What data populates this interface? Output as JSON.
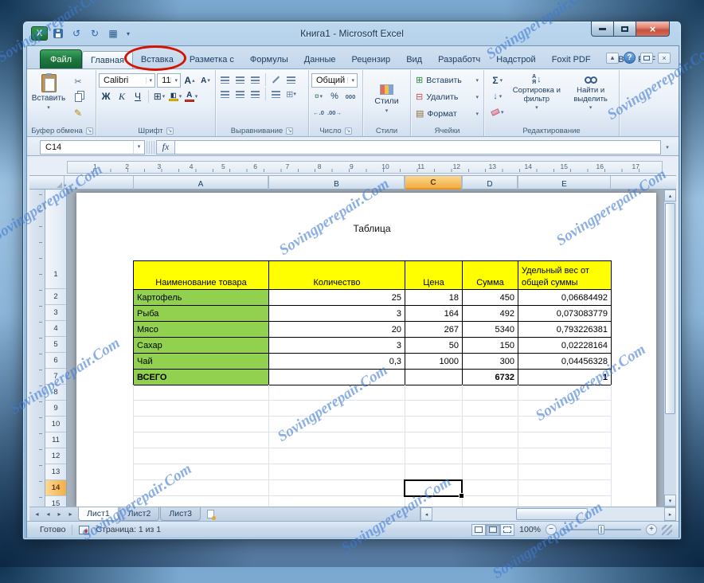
{
  "colors": {
    "table_header_yellow": "#ffff00",
    "table_row_green": "#92d050",
    "highlight_red": "#d21404",
    "header_highlight_orange": "#f3ae45",
    "file_tab_green": "#1e7a41"
  },
  "watermark": {
    "text": "Sovingperepair.Com"
  },
  "window": {
    "title": "Книга1 - Microsoft Excel"
  },
  "icons": {
    "dropdown": "▾",
    "dropup": "▴",
    "undo": "↺",
    "redo": "↻",
    "grid": "▦",
    "customize": "▾",
    "scissors": "✂",
    "brush": "✎",
    "sigma": "Σ",
    "fill_down": "↓",
    "borders": "⊞",
    "money": "¤",
    "percent": "%",
    "thousands": "000",
    "dec_inc": "←.0",
    "dec_dec": ".00→",
    "insert_cells": "⊞",
    "delete_cells": "⊟",
    "format_cells": "▤",
    "help": "?",
    "close_small": "×",
    "launcher": "↘",
    "nav_first": "◂",
    "nav_prev": "◂",
    "nav_next": "▸",
    "nav_last": "▸",
    "left": "◂",
    "right": "▸",
    "up": "▴",
    "down": "▾",
    "zoom_out": "−",
    "zoom_in": "+",
    "excel_logo": "X",
    "sort_a": "А",
    "sort_z": "Я",
    "sort_arrow": "↓",
    "grow_a": "А",
    "shrink_a": "А"
  },
  "ribbon": {
    "tabs": [
      "Файл",
      "Главная",
      "Вставка",
      "Разметка с",
      "Формулы",
      "Данные",
      "Рецензир",
      "Вид",
      "Разработч",
      "Надстрой",
      "Foxit PDF",
      "ABBYY PDF"
    ],
    "clipboard": {
      "paste": "Вставить",
      "label": "Буфер обмена"
    },
    "font": {
      "name": "Calibri",
      "size": "11",
      "bold": "Ж",
      "italic": "К",
      "underline": "Ч",
      "label": "Шрифт"
    },
    "alignment": {
      "label": "Выравнивание"
    },
    "number": {
      "format": "Общий",
      "label": "Число"
    },
    "styles": {
      "button": "Стили",
      "label": "Стили"
    },
    "cells": {
      "insert": "Вставить",
      "delete": "Удалить",
      "format": "Формат",
      "label": "Ячейки"
    },
    "editing": {
      "sort": "Сортировка и фильтр",
      "find": "Найти и выделить",
      "label": "Редактирование"
    }
  },
  "formula_bar": {
    "name_box": "C14",
    "fx": "fx"
  },
  "ruler": {
    "numbers": [
      "1",
      "2",
      "3",
      "4",
      "5",
      "6",
      "7",
      "8",
      "9",
      "10",
      "11",
      "12",
      "13",
      "14",
      "15",
      "16",
      "17"
    ]
  },
  "sheet": {
    "columns": [
      "A",
      "B",
      "C",
      "D",
      "E"
    ],
    "row_numbers": [
      "1",
      "2",
      "3",
      "4",
      "5",
      "6",
      "7",
      "8",
      "9",
      "10",
      "11",
      "12",
      "13",
      "14",
      "15"
    ],
    "page_title": "Таблица",
    "table": {
      "headers": [
        "Наименование товара",
        "Количество",
        "Цена",
        "Сумма",
        "Удельный вес от общей суммы"
      ],
      "rows": [
        [
          "Картофель",
          "25",
          "18",
          "450",
          "0,06684492"
        ],
        [
          "Рыба",
          "3",
          "164",
          "492",
          "0,073083779"
        ],
        [
          "Мясо",
          "20",
          "267",
          "5340",
          "0,793226381"
        ],
        [
          "Сахар",
          "3",
          "50",
          "150",
          "0,02228164"
        ],
        [
          "Чай",
          "0,3",
          "1000",
          "300",
          "0,04456328"
        ],
        [
          "ВСЕГО",
          "",
          "",
          "6732",
          "1"
        ]
      ]
    }
  },
  "sheet_tabs": [
    "Лист1",
    "Лист2",
    "Лист3"
  ],
  "status_bar": {
    "ready": "Готово",
    "page": "Страница: 1 из 1",
    "zoom": "100%"
  }
}
